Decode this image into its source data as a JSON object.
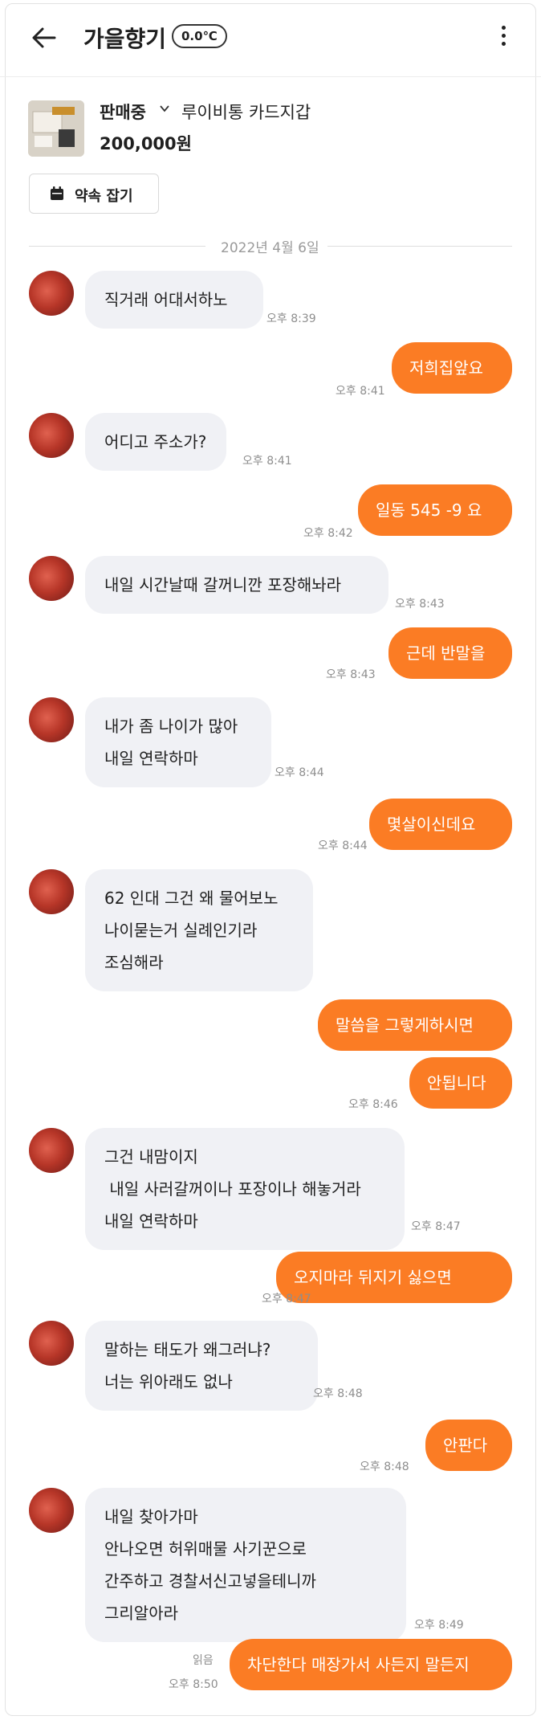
{
  "header": {
    "title": "가을향기",
    "temperature": "0.0℃",
    "icons": [
      "back-arrow-icon",
      "more-vertical-icon"
    ]
  },
  "product": {
    "status": "판매중",
    "name": "루이비통 카드지갑",
    "price": "200,000원",
    "appointment_button": "약속 잡기"
  },
  "date_divider": "2022년 4월 6일",
  "messages": [
    {
      "side": "in",
      "lines": [
        "직거래 어대서하노"
      ],
      "time": "오후 8:39"
    },
    {
      "side": "out",
      "lines": [
        "저희집앞요"
      ],
      "time": "오후 8:41"
    },
    {
      "side": "in",
      "lines": [
        "어디고 주소가?"
      ],
      "time": "오후 8:41"
    },
    {
      "side": "out",
      "lines": [
        "일동 545 -9 요"
      ],
      "time": "오후 8:42"
    },
    {
      "side": "in",
      "lines": [
        "내일 시간날때 갈꺼니깐 포장해놔라"
      ],
      "time": "오후 8:43"
    },
    {
      "side": "out",
      "lines": [
        "근데 반말을"
      ],
      "time": "오후 8:43"
    },
    {
      "side": "in",
      "lines": [
        "내가 좀 나이가 많아",
        "내일 연락하마"
      ],
      "time": "오후 8:44"
    },
    {
      "side": "out",
      "lines": [
        "몇살이신데요"
      ],
      "time": "오후 8:44"
    },
    {
      "side": "in",
      "lines": [
        "62 인대 그건 왜 물어보노",
        "나이묻는거 실례인기라",
        "조심해라"
      ],
      "time": ""
    },
    {
      "side": "out",
      "lines": [
        "말씀을 그렇게하시면"
      ],
      "time": ""
    },
    {
      "side": "out",
      "lines": [
        "안됩니다"
      ],
      "time": "오후 8:46"
    },
    {
      "side": "in",
      "lines": [
        "그건 내맘이지",
        " 내일 사러갈꺼이나 포장이나 해놓거라",
        "내일 연락하마"
      ],
      "time": "오후 8:47"
    },
    {
      "side": "out",
      "lines": [
        "오지마라 뒤지기 싫으면"
      ],
      "time": "오후 8:47"
    },
    {
      "side": "in",
      "lines": [
        "말하는 태도가 왜그러냐?",
        "너는 위아래도 없나"
      ],
      "time": "오후 8:48"
    },
    {
      "side": "out",
      "lines": [
        "안판다"
      ],
      "time": "오후 8:48"
    },
    {
      "side": "in",
      "lines": [
        "내일 찾아가마",
        "안나오면 허위매물 사기꾼으로",
        "간주하고 경찰서신고넣을테니까",
        "그리알아라"
      ],
      "time": "오후 8:49"
    },
    {
      "side": "out",
      "lines": [
        "차단한다 매장가서 사든지 말든지"
      ],
      "time": "오후 8:50",
      "read": "읽음"
    }
  ]
}
